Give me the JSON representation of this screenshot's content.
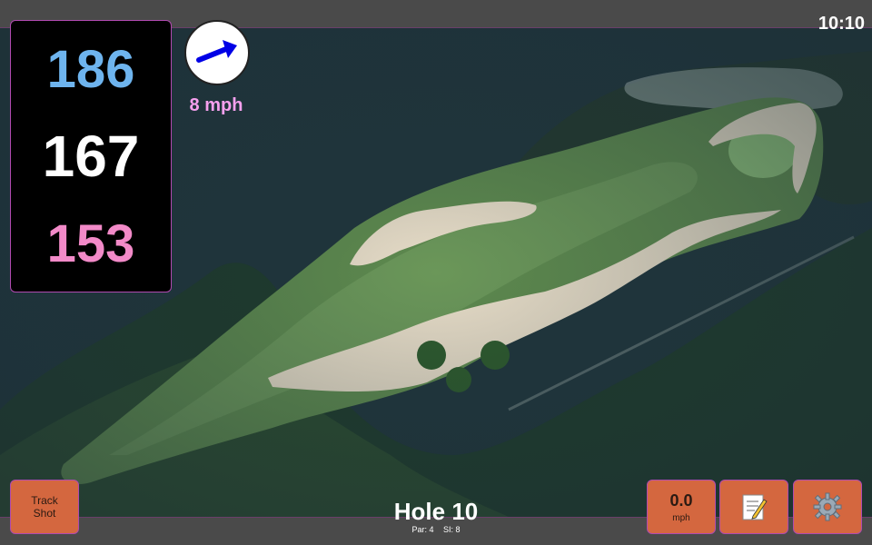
{
  "status": {
    "time": "10:10"
  },
  "distances": {
    "back": "186",
    "middle": "167",
    "front": "153"
  },
  "wind": {
    "speed": "8 mph",
    "direction_icon": "arrow-icon",
    "arrow_color": "#0000e6"
  },
  "hole": {
    "title": "Hole 10",
    "par": "Par: 4",
    "si": "SI: 8"
  },
  "buttons": {
    "track_shot": {
      "line1": "Track",
      "line2": "Shot"
    },
    "speed": {
      "value": "0.0",
      "unit": "mph"
    },
    "notes_icon": "notepad-icon",
    "settings_icon": "gear-icon"
  },
  "colors": {
    "accent": "#d4673f",
    "back_distance": "#6eb4ee",
    "front_distance": "#f28ac8",
    "wind_text": "#f6a0ee",
    "border": "#b04ab0"
  }
}
